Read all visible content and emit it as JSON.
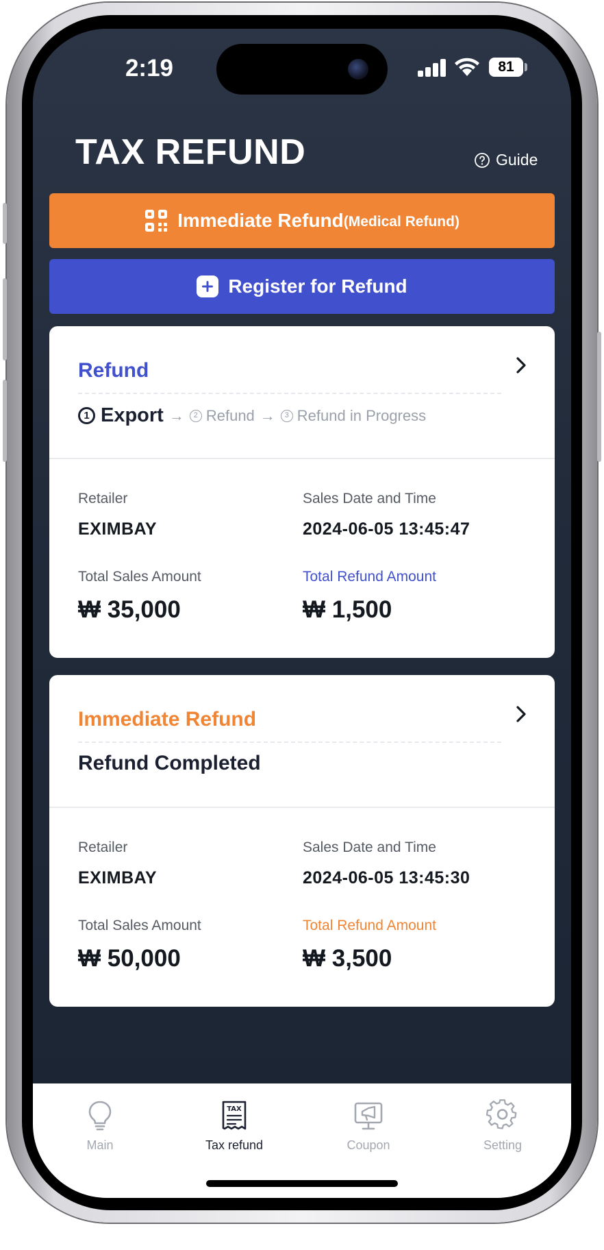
{
  "status_bar": {
    "time": "2:19",
    "battery": "81"
  },
  "header": {
    "title": "TAX REFUND",
    "guide_label": "Guide"
  },
  "buttons": {
    "immediate_refund": {
      "label": "Immediate Refund",
      "sublabel": "(Medical Refund)"
    },
    "register_refund": {
      "label": "Register for Refund"
    }
  },
  "cards": [
    {
      "type_label": "Refund",
      "type_color": "#4150cc",
      "steps": [
        {
          "number": "1",
          "label": "Export"
        },
        {
          "number": "2",
          "label": "Refund"
        },
        {
          "number": "3",
          "label": "Refund in Progress"
        }
      ],
      "retailer_label": "Retailer",
      "retailer": "EXIMBAY",
      "date_label": "Sales Date and Time",
      "date": "2024-06-05 13:45:47",
      "sales_label": "Total Sales Amount",
      "sales_amount": "₩ 35,000",
      "refund_label": "Total Refund Amount",
      "refund_amount": "₩ 1,500"
    },
    {
      "type_label": "Immediate Refund",
      "type_color": "#ef8535",
      "status": "Refund Completed",
      "retailer_label": "Retailer",
      "retailer": "EXIMBAY",
      "date_label": "Sales Date and Time",
      "date": "2024-06-05 13:45:30",
      "sales_label": "Total Sales Amount",
      "sales_amount": "₩ 50,000",
      "refund_label": "Total Refund Amount",
      "refund_amount": "₩ 3,500"
    }
  ],
  "tabs": [
    {
      "label": "Main",
      "icon": "lightbulb-icon",
      "active": false
    },
    {
      "label": "Tax refund",
      "icon": "tax-receipt-icon",
      "active": true
    },
    {
      "label": "Coupon",
      "icon": "coupon-screen-icon",
      "active": false
    },
    {
      "label": "Setting",
      "icon": "gear-icon",
      "active": false
    }
  ],
  "colors": {
    "orange": "#ef8535",
    "blue": "#4150cc",
    "background": "#232d3c"
  }
}
